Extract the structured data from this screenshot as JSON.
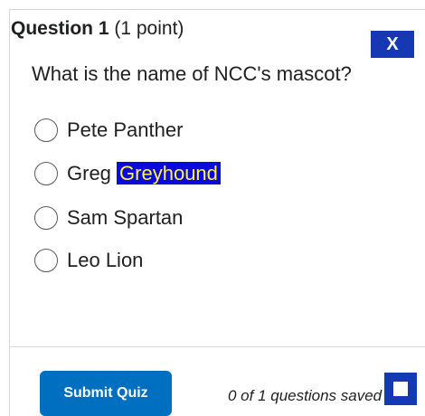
{
  "quiz": {
    "question_number": "Question 1",
    "points": "(1 point)",
    "question_text": "What is the name of NCC's mascot?",
    "options": [
      {
        "label": "Pete Panther",
        "selected": false
      },
      {
        "label_prefix": "Greg",
        "label_highlight": "Greyhound",
        "selected": false
      },
      {
        "label": "Sam Spartan",
        "selected": false
      },
      {
        "label": "Leo Lion",
        "selected": false
      }
    ]
  },
  "overlay": {
    "close_label": "X",
    "stop_icon": "square-stop-icon"
  },
  "footer": {
    "submit_label": "Submit Quiz",
    "status_text": "0 of 1 questions saved"
  },
  "colors": {
    "close_button": "#1538b5",
    "submit_button": "#006fbf",
    "highlight_background": "#0a0ad9",
    "highlight_text": "#fff44a"
  }
}
